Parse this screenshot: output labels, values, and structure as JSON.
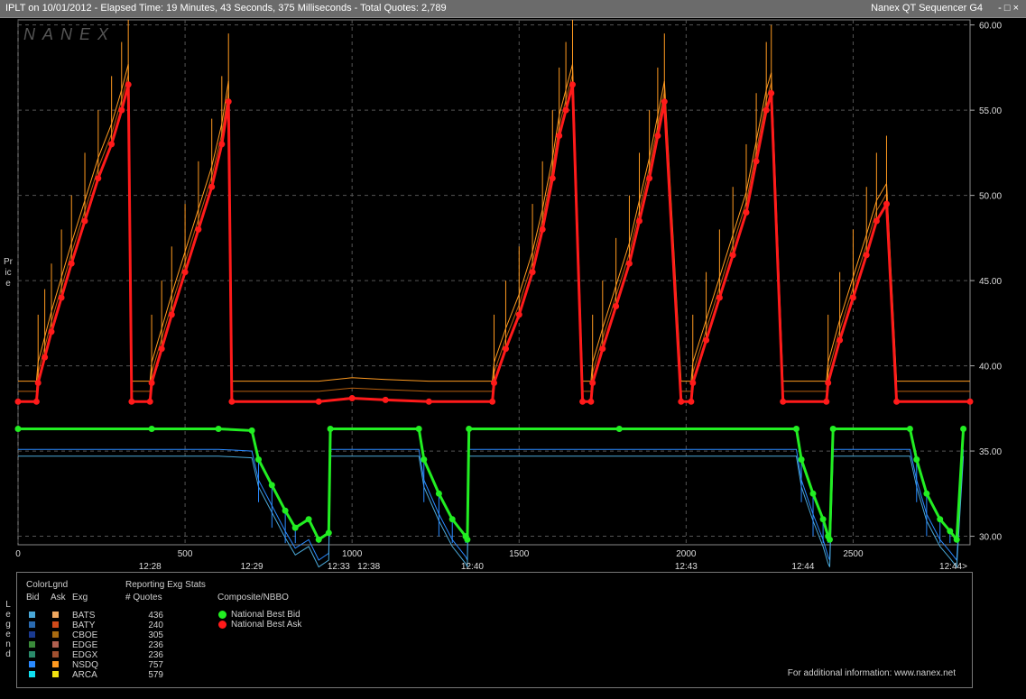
{
  "header": {
    "title": "IPLT on 10/01/2012  -  Elapsed Time: 19 Minutes, 43 Seconds, 375 Milliseconds  -  Total Quotes: 2,789",
    "app_name": "Nanex QT Sequencer G4",
    "controls": "-  □  ×"
  },
  "watermark": "NANEX",
  "y_axis_label": "Price",
  "legend_side_label": "Legend",
  "chart_data": {
    "type": "line",
    "ylim": [
      29.5,
      60.3
    ],
    "xlim": [
      0,
      2850
    ],
    "y_ticks": [
      "60.00",
      "55.00",
      "50.00",
      "45.00",
      "40.00",
      "35.00",
      "30.00"
    ],
    "x_ticks": [
      "0",
      "500",
      "1000",
      "1500",
      "2000",
      "2500"
    ],
    "time_labels": [
      {
        "x": 395,
        "label": "12:28"
      },
      {
        "x": 700,
        "label": "12:29"
      },
      {
        "x": 960,
        "label": "12:33"
      },
      {
        "x": 1050,
        "label": "12:38"
      },
      {
        "x": 1360,
        "label": "12:40"
      },
      {
        "x": 2000,
        "label": "12:43"
      },
      {
        "x": 2350,
        "label": "12:44"
      },
      {
        "x": 2800,
        "label": "12:44>"
      }
    ],
    "grid": true,
    "series": [
      {
        "name": "National Best Ask",
        "color": "#ff1a1a",
        "points": [
          [
            0,
            37.9
          ],
          [
            55,
            37.9
          ],
          [
            60,
            39
          ],
          [
            80,
            40.5
          ],
          [
            100,
            42
          ],
          [
            130,
            44
          ],
          [
            160,
            46
          ],
          [
            200,
            48.5
          ],
          [
            240,
            51
          ],
          [
            280,
            53
          ],
          [
            310,
            55
          ],
          [
            330,
            56.5
          ],
          [
            340,
            37.9
          ],
          [
            395,
            37.9
          ],
          [
            400,
            39
          ],
          [
            430,
            41
          ],
          [
            460,
            43
          ],
          [
            500,
            45.5
          ],
          [
            540,
            48
          ],
          [
            580,
            50.5
          ],
          [
            610,
            53
          ],
          [
            630,
            55.5
          ],
          [
            640,
            37.9
          ],
          [
            900,
            37.9
          ],
          [
            1000,
            38.1
          ],
          [
            1100,
            38
          ],
          [
            1230,
            37.9
          ],
          [
            1420,
            37.9
          ],
          [
            1425,
            39
          ],
          [
            1460,
            41
          ],
          [
            1500,
            43
          ],
          [
            1540,
            45.5
          ],
          [
            1570,
            48
          ],
          [
            1600,
            51
          ],
          [
            1620,
            53.5
          ],
          [
            1640,
            55
          ],
          [
            1660,
            56.5
          ],
          [
            1690,
            37.9
          ],
          [
            1715,
            37.9
          ],
          [
            1720,
            39
          ],
          [
            1750,
            41
          ],
          [
            1790,
            43.5
          ],
          [
            1830,
            46
          ],
          [
            1860,
            48.5
          ],
          [
            1890,
            51
          ],
          [
            1915,
            53.5
          ],
          [
            1935,
            55.5
          ],
          [
            1985,
            37.9
          ],
          [
            2015,
            37.9
          ],
          [
            2020,
            39
          ],
          [
            2060,
            41.5
          ],
          [
            2100,
            44
          ],
          [
            2140,
            46.5
          ],
          [
            2180,
            49
          ],
          [
            2210,
            52
          ],
          [
            2240,
            55
          ],
          [
            2255,
            56
          ],
          [
            2290,
            37.9
          ],
          [
            2420,
            37.9
          ],
          [
            2425,
            39
          ],
          [
            2460,
            41.5
          ],
          [
            2500,
            44
          ],
          [
            2540,
            46.5
          ],
          [
            2570,
            48.5
          ],
          [
            2600,
            49.5
          ],
          [
            2630,
            37.9
          ],
          [
            2850,
            37.9
          ]
        ]
      },
      {
        "name": "National Best Bid",
        "color": "#22ee22",
        "points": [
          [
            0,
            36.3
          ],
          [
            400,
            36.3
          ],
          [
            600,
            36.3
          ],
          [
            700,
            36.2
          ],
          [
            720,
            34.5
          ],
          [
            760,
            33
          ],
          [
            800,
            31.5
          ],
          [
            830,
            30.5
          ],
          [
            870,
            31
          ],
          [
            900,
            29.8
          ],
          [
            930,
            30.2
          ],
          [
            935,
            36.3
          ],
          [
            1200,
            36.3
          ],
          [
            1215,
            34.5
          ],
          [
            1260,
            32.5
          ],
          [
            1300,
            31
          ],
          [
            1340,
            30
          ],
          [
            1345,
            29.8
          ],
          [
            1350,
            36.3
          ],
          [
            1800,
            36.3
          ],
          [
            2330,
            36.3
          ],
          [
            2345,
            34.5
          ],
          [
            2380,
            32.5
          ],
          [
            2410,
            31
          ],
          [
            2425,
            30
          ],
          [
            2430,
            29.8
          ],
          [
            2440,
            36.3
          ],
          [
            2670,
            36.3
          ],
          [
            2690,
            34.5
          ],
          [
            2720,
            32.5
          ],
          [
            2760,
            31
          ],
          [
            2790,
            30.3
          ],
          [
            2810,
            29.8
          ],
          [
            2830,
            36.3
          ]
        ]
      }
    ]
  },
  "legend": {
    "color_legend": "ColorLgnd",
    "col_bid": "Bid",
    "col_ask": "Ask",
    "col_exg": "Exg",
    "stats_title": "Reporting Exg Stats",
    "col_quotes": "# Quotes",
    "composite_title": "Composite/NBBO",
    "nbb_label": "National Best Bid",
    "nbo_label": "National Best Ask",
    "footer": "For additional information: www.nanex.net",
    "exchanges": [
      {
        "name": "BATS",
        "quotes": "436",
        "bid_color": "#4aa8d8",
        "ask_color": "#f0a860"
      },
      {
        "name": "BATY",
        "quotes": "240",
        "bid_color": "#2a6ab0",
        "ask_color": "#d04a1a"
      },
      {
        "name": "CBOE",
        "quotes": "305",
        "bid_color": "#1a3a90",
        "ask_color": "#a86a10"
      },
      {
        "name": "EDGE",
        "quotes": "236",
        "bid_color": "#3a8a3a",
        "ask_color": "#b06050"
      },
      {
        "name": "EDGX",
        "quotes": "236",
        "bid_color": "#2a8a6a",
        "ask_color": "#a05030"
      },
      {
        "name": "NSDQ",
        "quotes": "757",
        "bid_color": "#2a8aff",
        "ask_color": "#ff9a20"
      },
      {
        "name": "ARCA",
        "quotes": "579",
        "bid_color": "#10e0f0",
        "ask_color": "#f0e010"
      }
    ],
    "nbb_color": "#22ee22",
    "nbo_color": "#ff1a1a"
  }
}
